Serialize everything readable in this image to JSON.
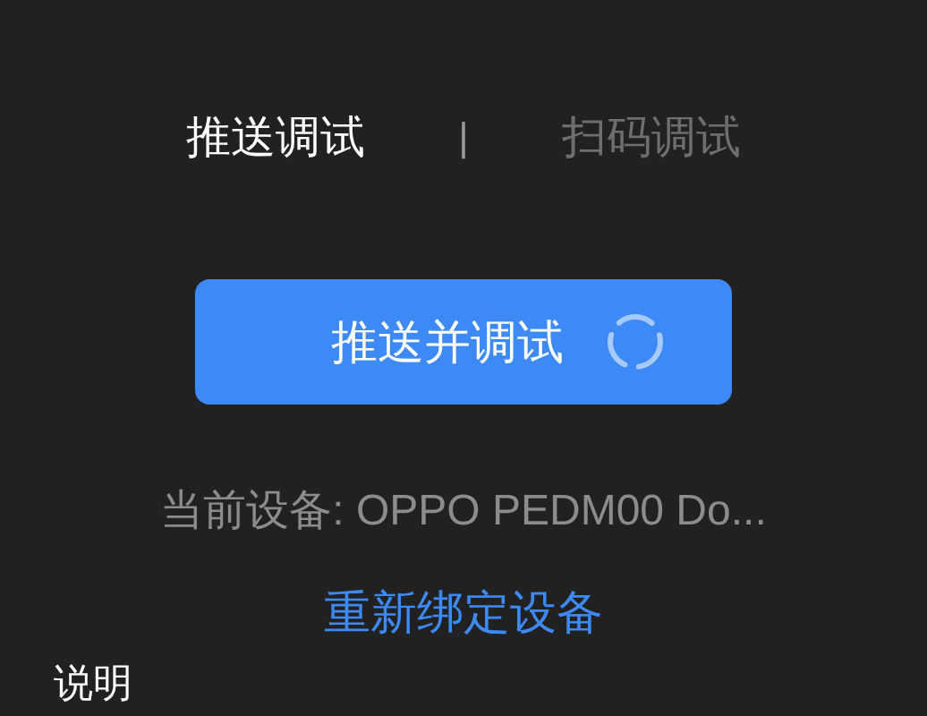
{
  "tabs": [
    {
      "label": "推送调试",
      "selected": true
    },
    {
      "label": "扫码调试",
      "selected": false
    }
  ],
  "tab_separator": "|",
  "push_button": {
    "label": "推送并调试",
    "loading": true
  },
  "current_device": "当前设备: OPPO PEDM00 Do...",
  "rebind_link": "重新绑定设备",
  "section_title": "说明"
}
